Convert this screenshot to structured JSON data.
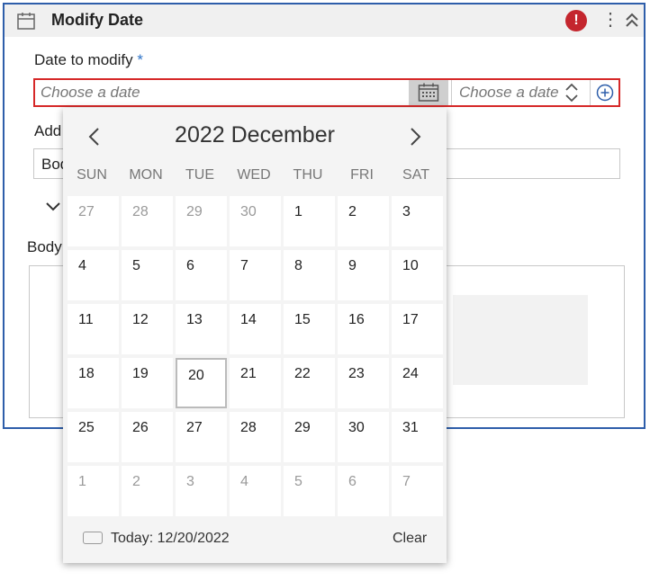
{
  "header": {
    "title": "Modify Date",
    "error_badge": "!"
  },
  "form": {
    "date_label": "Date to modify",
    "required_mark": "*",
    "date_placeholder": "Choose a date",
    "time_placeholder": "Choose a date",
    "add_label": "Add",
    "add_value": "Bod",
    "body_label": "Body"
  },
  "calendar": {
    "month_label": "2022 December",
    "weekdays": [
      "SUN",
      "MON",
      "TUE",
      "WED",
      "THU",
      "FRI",
      "SAT"
    ],
    "weeks": [
      [
        {
          "d": "27",
          "m": true
        },
        {
          "d": "28",
          "m": true
        },
        {
          "d": "29",
          "m": true
        },
        {
          "d": "30",
          "m": true
        },
        {
          "d": "1"
        },
        {
          "d": "2"
        },
        {
          "d": "3"
        }
      ],
      [
        {
          "d": "4"
        },
        {
          "d": "5"
        },
        {
          "d": "6"
        },
        {
          "d": "7"
        },
        {
          "d": "8"
        },
        {
          "d": "9"
        },
        {
          "d": "10"
        }
      ],
      [
        {
          "d": "11"
        },
        {
          "d": "12"
        },
        {
          "d": "13"
        },
        {
          "d": "14"
        },
        {
          "d": "15"
        },
        {
          "d": "16"
        },
        {
          "d": "17"
        }
      ],
      [
        {
          "d": "18"
        },
        {
          "d": "19"
        },
        {
          "d": "20",
          "t": true
        },
        {
          "d": "21"
        },
        {
          "d": "22"
        },
        {
          "d": "23"
        },
        {
          "d": "24"
        }
      ],
      [
        {
          "d": "25"
        },
        {
          "d": "26"
        },
        {
          "d": "27"
        },
        {
          "d": "28"
        },
        {
          "d": "29"
        },
        {
          "d": "30"
        },
        {
          "d": "31"
        }
      ],
      [
        {
          "d": "1",
          "m": true
        },
        {
          "d": "2",
          "m": true
        },
        {
          "d": "3",
          "m": true
        },
        {
          "d": "4",
          "m": true
        },
        {
          "d": "5",
          "m": true
        },
        {
          "d": "6",
          "m": true
        },
        {
          "d": "7",
          "m": true
        }
      ]
    ],
    "today_label": "Today: 12/20/2022",
    "clear_label": "Clear"
  },
  "colors": {
    "accent": "#2e5eaa",
    "error": "#c4262e",
    "invalid_border": "#d62828"
  }
}
